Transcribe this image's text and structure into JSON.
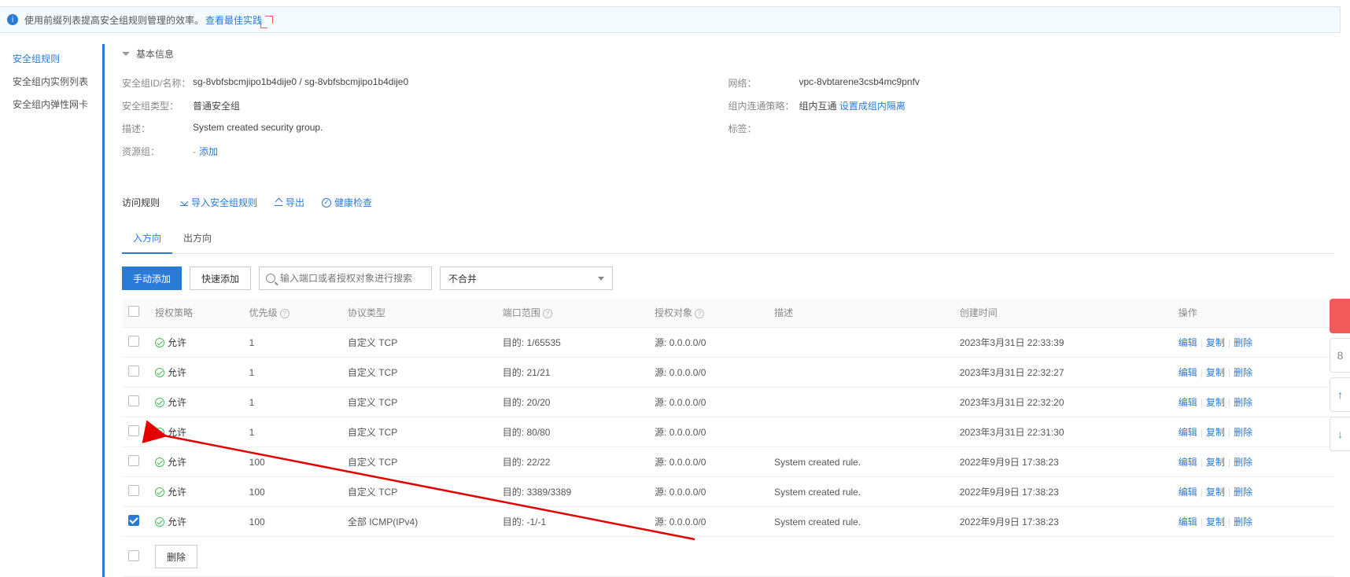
{
  "notice": {
    "text": "使用前缀列表提高安全组规则管理的效率。",
    "best_link": "查看最佳实践"
  },
  "sidebar": {
    "items": [
      {
        "label": "安全组规则"
      },
      {
        "label": "安全组内实例列表"
      },
      {
        "label": "安全组内弹性网卡"
      }
    ],
    "active_index": 0
  },
  "basic": {
    "title": "基本信息",
    "rows_left": [
      {
        "label": "安全组ID/名称：",
        "value": "sg-8vbfsbcmjipo1b4dije0 / sg-8vbfsbcmjipo1b4dije0"
      },
      {
        "label": "安全组类型：",
        "value": "普通安全组"
      },
      {
        "label": "描述：",
        "value": "System created security group."
      },
      {
        "label": "资源组：",
        "prefix": "-",
        "link": "添加"
      }
    ],
    "rows_right": [
      {
        "label": "网络：",
        "value": "vpc-8vbtarene3csb4mc9pnfv"
      },
      {
        "label": "组内连通策略：",
        "value": "组内互通",
        "link": "设置成组内隔离"
      },
      {
        "label": "标签："
      }
    ]
  },
  "rules": {
    "header": {
      "title": "访问规则",
      "import": "导入安全组规则",
      "export": "导出",
      "health": "健康检查"
    },
    "tabs": [
      {
        "key": "in",
        "label": "入方向"
      },
      {
        "key": "out",
        "label": "出方向"
      }
    ],
    "active_tab": 0,
    "toolbar": {
      "add_manual": "手动添加",
      "add_quick": "快速添加",
      "search_placeholder": "输入端口或者授权对象进行搜索",
      "merge_select": "不合并"
    },
    "columns": {
      "policy": "授权策略",
      "priority": "优先级",
      "protocol": "协议类型",
      "port": "端口范围",
      "target": "授权对象",
      "desc": "描述",
      "created": "创建时间",
      "ops": "操作"
    },
    "port_prefix": "目的:",
    "target_prefix": "源:",
    "policy_allow": "允许",
    "ops_labels": {
      "edit": "编辑",
      "copy": "复制",
      "delete": "删除"
    },
    "footer_delete": "删除",
    "rows": [
      {
        "checked": false,
        "policy": "允许",
        "priority": "1",
        "protocol": "自定义 TCP",
        "port": "1/65535",
        "target": "0.0.0.0/0",
        "desc": "",
        "created": "2023年3月31日 22:33:39"
      },
      {
        "checked": false,
        "policy": "允许",
        "priority": "1",
        "protocol": "自定义 TCP",
        "port": "21/21",
        "target": "0.0.0.0/0",
        "desc": "",
        "created": "2023年3月31日 22:32:27"
      },
      {
        "checked": false,
        "policy": "允许",
        "priority": "1",
        "protocol": "自定义 TCP",
        "port": "20/20",
        "target": "0.0.0.0/0",
        "desc": "",
        "created": "2023年3月31日 22:32:20"
      },
      {
        "checked": false,
        "policy": "允许",
        "priority": "1",
        "protocol": "自定义 TCP",
        "port": "80/80",
        "target": "0.0.0.0/0",
        "desc": "",
        "created": "2023年3月31日 22:31:30"
      },
      {
        "checked": false,
        "policy": "允许",
        "priority": "100",
        "protocol": "自定义 TCP",
        "port": "22/22",
        "target": "0.0.0.0/0",
        "desc": "System created rule.",
        "created": "2022年9月9日 17:38:23"
      },
      {
        "checked": false,
        "policy": "允许",
        "priority": "100",
        "protocol": "自定义 TCP",
        "port": "3389/3389",
        "target": "0.0.0.0/0",
        "desc": "System created rule.",
        "created": "2022年9月9日 17:38:23"
      },
      {
        "checked": true,
        "policy": "允许",
        "priority": "100",
        "protocol": "全部 ICMP(IPv4)",
        "port": "-1/-1",
        "target": "0.0.0.0/0",
        "desc": "System created rule.",
        "created": "2022年9月9日 17:38:23"
      }
    ]
  },
  "floats": [
    "",
    "8",
    "↑",
    "↓"
  ]
}
